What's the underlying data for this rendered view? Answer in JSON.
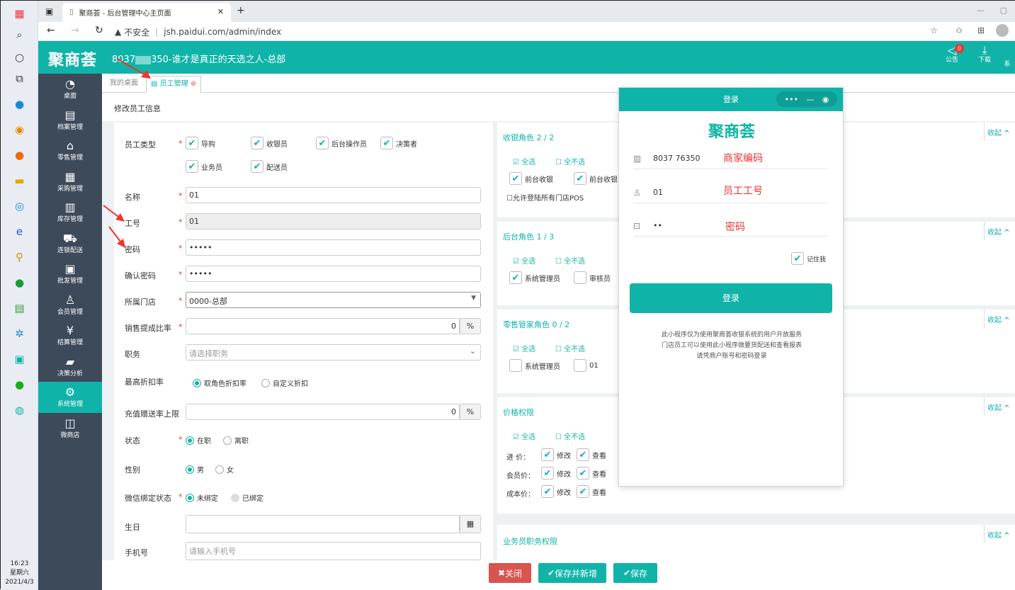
{
  "taskbar": {
    "time": "16:23",
    "weekday": "星期六",
    "date": "2021/4/3"
  },
  "browser": {
    "tab_title": "聚商荟 - 后台管理中心主页面",
    "security": "不安全",
    "url": "jsh.paidui.com/admin/index"
  },
  "header": {
    "logo": "聚商荟",
    "shop_prefix": "8037",
    "shop_suffix": "350-谁才是真正的天选之人-总部",
    "notice_label": "公告",
    "notice_badge": "0",
    "download_label": "下载",
    "system_label": "系"
  },
  "sidebar": {
    "items": [
      {
        "label": "桌面",
        "icon": "dashboard-icon"
      },
      {
        "label": "档案管理",
        "icon": "archive-icon"
      },
      {
        "label": "零售管理",
        "icon": "store-icon"
      },
      {
        "label": "采购管理",
        "icon": "purchase-icon"
      },
      {
        "label": "库存管理",
        "icon": "inventory-icon"
      },
      {
        "label": "连锁配送",
        "icon": "delivery-icon"
      },
      {
        "label": "批发管理",
        "icon": "wholesale-icon"
      },
      {
        "label": "会员管理",
        "icon": "member-icon"
      },
      {
        "label": "结算管理",
        "icon": "settlement-icon"
      },
      {
        "label": "决策分析",
        "icon": "analysis-icon"
      },
      {
        "label": "系统管理",
        "icon": "settings-icon"
      },
      {
        "label": "微商店",
        "icon": "shop-bag-icon"
      }
    ]
  },
  "tabs": {
    "desktop": "我的桌面",
    "employee": "员工管理"
  },
  "page": {
    "subtitle": "修改员工信息"
  },
  "form": {
    "employee_type_label": "员工类型",
    "types": [
      "导购",
      "收银员",
      "后台操作员",
      "决策者",
      "业务员",
      "配送员"
    ],
    "name_label": "名称",
    "name_value": "01",
    "id_label": "工号",
    "id_value": "01",
    "password_label": "密码",
    "password_value": "•••••",
    "confirm_label": "确认密码",
    "confirm_value": "•••••",
    "store_label": "所属门店",
    "store_value": "0000-总部",
    "commission_label": "销售提成比率",
    "commission_value": "0",
    "percent": "%",
    "position_label": "职务",
    "position_placeholder": "请选择职务",
    "discount_label": "最高折扣率",
    "discount_opt1": "取角色折扣率",
    "discount_opt2": "自定义折扣",
    "recharge_label": "充值赠送率上限",
    "recharge_value": "0",
    "status_label": "状态",
    "status_opt1": "在职",
    "status_opt2": "离职",
    "gender_label": "性别",
    "gender_opt1": "男",
    "gender_opt2": "女",
    "wechat_label": "微信绑定状态",
    "wechat_opt1": "未绑定",
    "wechat_opt2": "已绑定",
    "birthday_label": "生日",
    "phone_label": "手机号",
    "phone_placeholder": "请输入手机号"
  },
  "roles": {
    "cashier_title": "收银角色 2 / 2",
    "backend_title": "后台角色 1 / 3",
    "retail_title": "零售管家角色 0 / 2",
    "price_title": "价格权限",
    "sales_title": "业务员职务权限",
    "collapse": "收起",
    "select_all": "全选",
    "select_none": "全不选",
    "cashier_items": [
      "前台收银",
      "前台收银"
    ],
    "allow_pos": "允许登陆所有门店POS",
    "backend_items": [
      "系统管理员",
      "审核员"
    ],
    "retail_items": [
      "系统管理员",
      "01"
    ],
    "price_rows": [
      "进 价：",
      "会员价：",
      "成本价："
    ],
    "modify": "修改",
    "view": "查看"
  },
  "footer": {
    "close": "关闭",
    "save_new": "保存并新增",
    "save": "保存"
  },
  "popup": {
    "title": "登录",
    "logo": "聚商荟",
    "merchant_value": "8037  76350",
    "merchant_note": "商家编码",
    "employee_value": "01",
    "employee_note": "员工工号",
    "password_value": "••",
    "password_note": "密码",
    "remember": "记住我",
    "login_button": "登录",
    "note1": "此小程序仅为使用聚商荟收银系统的用户开放服务",
    "note2": "门店员工可以使用此小程序做要货配送和查看报表",
    "note3": "请凭商户账号和密码登录"
  },
  "colors": {
    "brand": "#10b3a8",
    "sidebar": "#3d4a5a",
    "danger": "#d9534f",
    "annotation": "#e33333"
  }
}
